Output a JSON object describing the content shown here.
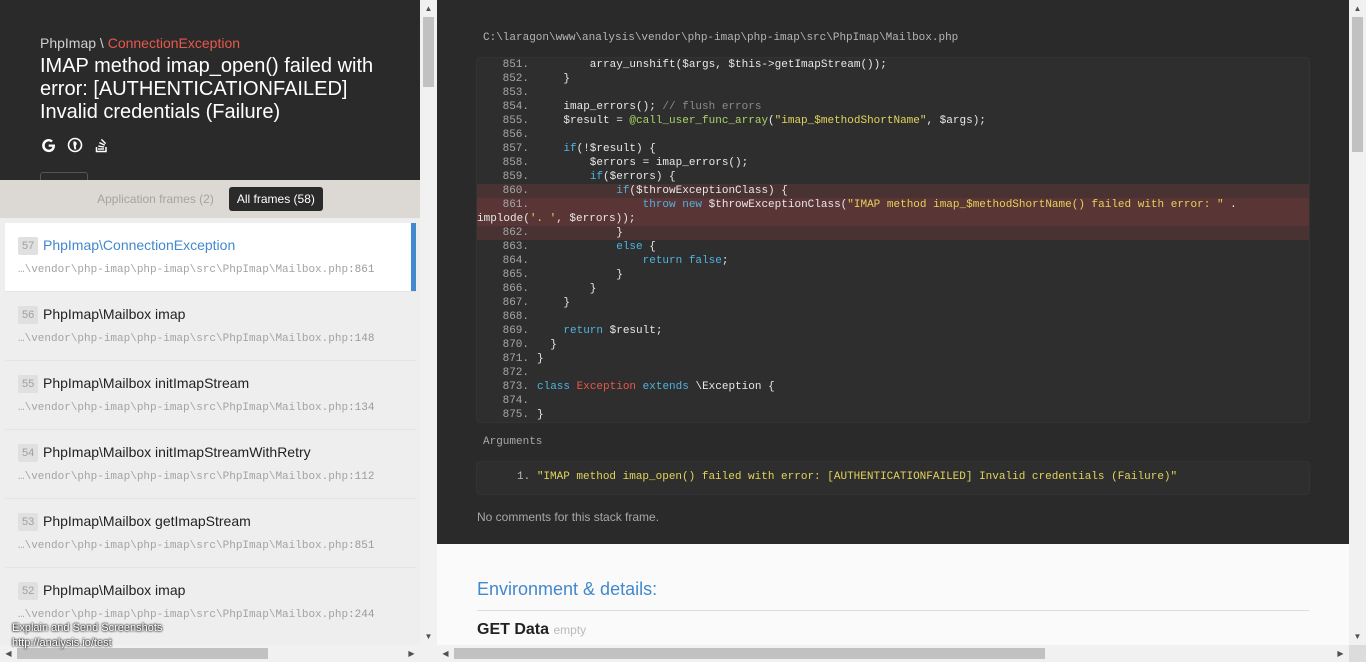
{
  "exception": {
    "namespace": "PhpImap \\ ",
    "class_name": "ConnectionException",
    "message": "IMAP method imap_open() failed with error: [AUTHENTICATIONFAILED] Invalid credentials (Failure)",
    "search_icons": [
      "google-icon",
      "duckduckgo-icon",
      "stackoverflow-icon"
    ]
  },
  "filters": {
    "app_frames": "Application frames (2)",
    "all_frames": "All frames (58)"
  },
  "frames": [
    {
      "index": "57",
      "class": "PhpImap\\ConnectionException",
      "file": "…\\vendor\\php-imap\\php-imap\\src\\PhpImap\\Mailbox.php",
      "line": ":861",
      "active": true
    },
    {
      "index": "56",
      "class": "PhpImap\\Mailbox imap",
      "file": "…\\vendor\\php-imap\\php-imap\\src\\PhpImap\\Mailbox.php",
      "line": ":148"
    },
    {
      "index": "55",
      "class": "PhpImap\\Mailbox initImapStream",
      "file": "…\\vendor\\php-imap\\php-imap\\src\\PhpImap\\Mailbox.php",
      "line": ":134"
    },
    {
      "index": "54",
      "class": "PhpImap\\Mailbox initImapStreamWithRetry",
      "file": "…\\vendor\\php-imap\\php-imap\\src\\PhpImap\\Mailbox.php",
      "line": ":112"
    },
    {
      "index": "53",
      "class": "PhpImap\\Mailbox getImapStream",
      "file": "…\\vendor\\php-imap\\php-imap\\src\\PhpImap\\Mailbox.php",
      "line": ":851"
    },
    {
      "index": "52",
      "class": "PhpImap\\Mailbox imap",
      "file": "…\\vendor\\php-imap\\php-imap\\src\\PhpImap\\Mailbox.php",
      "line": ":244"
    }
  ],
  "footer": {
    "explain_link": "Explain and Send Screenshots",
    "url": "http://analysis.io/test"
  },
  "code": {
    "file_path": "C:\\laragon\\www\\analysis\\vendor\\php-imap\\php-imap\\src\\PhpImap\\Mailbox.php",
    "highlight_line": "861.",
    "lines": [
      {
        "n": "851.",
        "html": "        array_unshift($args, $this->getImapStream());"
      },
      {
        "n": "852.",
        "html": "    }"
      },
      {
        "n": "853.",
        "html": ""
      },
      {
        "n": "854.",
        "html": "    imap_errors(); <span class=\"cm\">// flush errors</span>"
      },
      {
        "n": "855.",
        "html": "    $result = <span class=\"fn\">@call_user_func_array</span>(<span class=\"str\">\"imap_$methodShortName\"</span>, $args);"
      },
      {
        "n": "856.",
        "html": ""
      },
      {
        "n": "857.",
        "html": "    <span class=\"kw\">if</span>(!$result) {"
      },
      {
        "n": "858.",
        "html": "        $errors = imap_errors();"
      },
      {
        "n": "859.",
        "html": "        <span class=\"kw\">if</span>($errors) {"
      },
      {
        "n": "860.",
        "html": "            <span class=\"kw\">if</span>($throwExceptionClass) {",
        "hl": "soft"
      },
      {
        "n": "861.",
        "html": "                <span class=\"kw\">throw new</span> $throwExceptionClass(<span class=\"str\">\"IMAP method imap_$methodShortName() failed with error: \"</span> .",
        "hl": "strong"
      },
      {
        "n": "",
        "html": "implode(<span class=\"str\">'. '</span>, $errors));",
        "hl": "strong",
        "wrap": true
      },
      {
        "n": "862.",
        "html": "            }",
        "hl": "soft"
      },
      {
        "n": "863.",
        "html": "            <span class=\"kw\">else</span> {"
      },
      {
        "n": "864.",
        "html": "                <span class=\"kw\">return false</span>;"
      },
      {
        "n": "865.",
        "html": "            }"
      },
      {
        "n": "866.",
        "html": "        }"
      },
      {
        "n": "867.",
        "html": "    }"
      },
      {
        "n": "868.",
        "html": ""
      },
      {
        "n": "869.",
        "html": "    <span class=\"kw\">return</span> $result;"
      },
      {
        "n": "870.",
        "html": "  }"
      },
      {
        "n": "871.",
        "html": "}"
      },
      {
        "n": "872.",
        "html": ""
      },
      {
        "n": "873.",
        "html": "<span class=\"kw\">class</span> <span class=\"kw2\">Exception</span> <span class=\"kw\">extends</span> \\Exception {"
      },
      {
        "n": "874.",
        "html": ""
      },
      {
        "n": "875.",
        "html": "}"
      }
    ]
  },
  "arguments": {
    "label": "Arguments",
    "items": [
      {
        "num": "1.",
        "value": "\"IMAP method imap_open() failed with error: [AUTHENTICATIONFAILED] Invalid credentials (Failure)\""
      }
    ]
  },
  "comments": "No comments for this stack frame.",
  "details": {
    "title": "Environment & details:",
    "get_label": "GET Data",
    "get_empty": "empty"
  },
  "colors": {
    "accent": "#4288ce",
    "exception_red": "#e8584c",
    "dark_bg": "#2a2a2a"
  }
}
